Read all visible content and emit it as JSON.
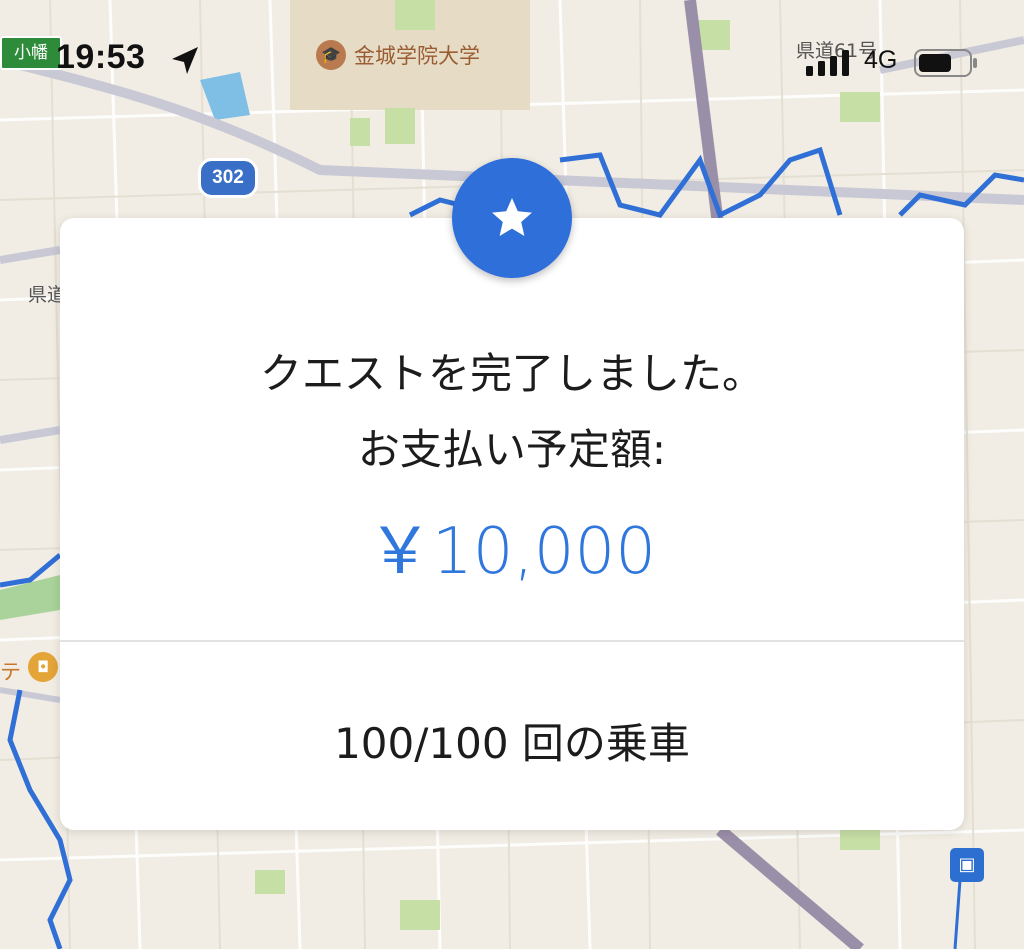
{
  "status_bar": {
    "time": "19:53",
    "network": "4G",
    "location_icon": "location-arrow-icon",
    "signal_icon": "cellular-signal-icon",
    "battery_icon": "battery-icon"
  },
  "map": {
    "route_sign": "小幡",
    "route_number": "302",
    "university_label": "金城学院大学",
    "pref_road_61": "県道61号",
    "pref_road_left": "県道",
    "poi_partial": "テ",
    "colors": {
      "background": "#f1ede4",
      "route": "#2f6fd6",
      "park": "#c6dfa5",
      "water": "#7fbfe6"
    }
  },
  "quest_card": {
    "star_icon": "star-icon",
    "message_line1": "クエストを完了しました。",
    "message_line2": "お支払い予定額:",
    "amount": "￥10,000",
    "rides_progress": "100/100 回の乗車",
    "colors": {
      "accent": "#2e6fd9",
      "amount": "#2f76dd"
    }
  }
}
